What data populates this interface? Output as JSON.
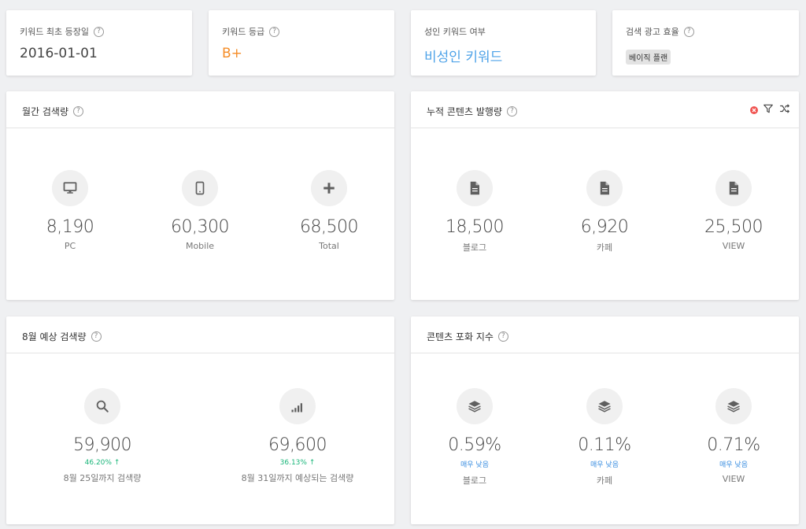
{
  "top_cards": [
    {
      "label": "키워드 최초 등장일",
      "value": "2016-01-01"
    },
    {
      "label": "키워드 등급",
      "value": "B+"
    },
    {
      "label": "성인 키워드 여부",
      "value": "비성인 키워드"
    },
    {
      "label": "검색 광고 효율",
      "badge": "베이직 플랜"
    }
  ],
  "help_glyph": "?",
  "monthly": {
    "title": "월간 검색량",
    "stats": [
      {
        "icon": "desktop-icon",
        "value": "8,190",
        "label": "PC"
      },
      {
        "icon": "mobile-icon",
        "value": "60,300",
        "label": "Mobile"
      },
      {
        "icon": "plus-icon",
        "value": "68,500",
        "label": "Total"
      }
    ]
  },
  "cumulative": {
    "title": "누적 콘텐츠 발행량",
    "stats": [
      {
        "icon": "document-icon",
        "value": "18,500",
        "label": "블로그"
      },
      {
        "icon": "document-icon",
        "value": "6,920",
        "label": "카페"
      },
      {
        "icon": "document-icon",
        "value": "25,500",
        "label": "VIEW"
      }
    ]
  },
  "forecast": {
    "title": "8월 예상 검색량",
    "stats": [
      {
        "icon": "search-icon",
        "value": "59,900",
        "change": "46.20%",
        "arrow": "↑",
        "label": "8월 25일까지 검색량"
      },
      {
        "icon": "signal-icon",
        "value": "69,600",
        "change": "36.13%",
        "arrow": "↑",
        "label": "8월 31일까지 예상되는 검색량"
      }
    ]
  },
  "saturation": {
    "title": "콘텐츠 포화 지수",
    "stats": [
      {
        "icon": "layers-icon",
        "value": "0.59%",
        "level": "매우 낮음",
        "label": "블로그"
      },
      {
        "icon": "layers-icon",
        "value": "0.11%",
        "level": "매우 낮음",
        "label": "카페"
      },
      {
        "icon": "layers-icon",
        "value": "0.71%",
        "level": "매우 낮음",
        "label": "VIEW"
      }
    ]
  },
  "colors": {
    "accent_orange": "#f58d28",
    "accent_blue": "#4fa3e8",
    "change_green": "#1ab67a",
    "level_blue": "#3a8ee0"
  }
}
